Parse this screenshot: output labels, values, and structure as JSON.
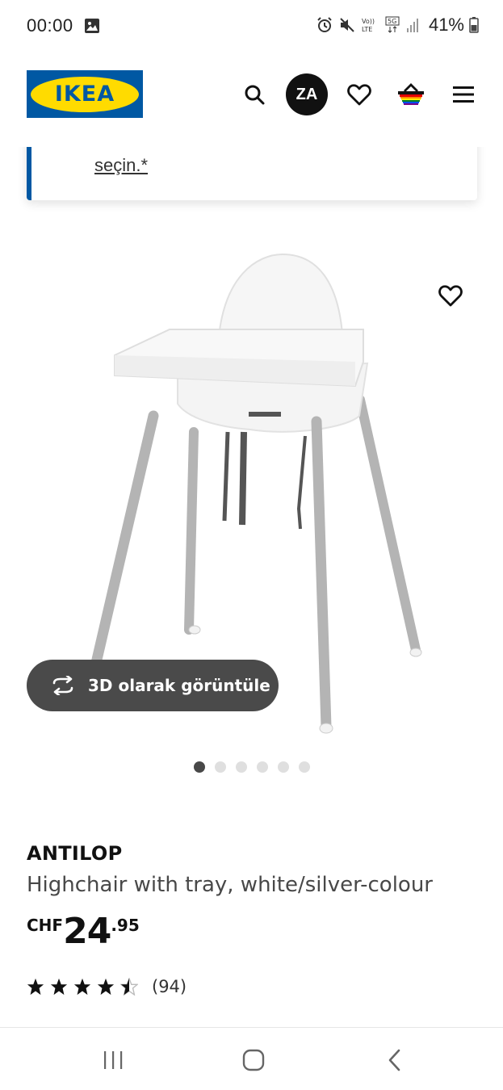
{
  "status_bar": {
    "time": "00:00",
    "battery": "41%",
    "icons": [
      "gallery-icon",
      "alarm-icon",
      "mute-icon",
      "volte-icon",
      "5g-icon",
      "signal-icon",
      "battery-icon"
    ]
  },
  "header": {
    "logo_text": "IKEA",
    "account_initials": "ZA",
    "icons": [
      "search-icon",
      "heart-icon",
      "basket-icon",
      "menu-icon"
    ]
  },
  "notice": {
    "link_text": "seçin.*"
  },
  "gallery": {
    "view_3d_label": "3D olarak görüntüle",
    "total_images": 6,
    "active_index": 0
  },
  "product": {
    "name": "ANTILOP",
    "description": "Highchair with tray, white/silver-colour",
    "price": {
      "currency": "CHF",
      "integer": "24",
      "decimal": ".95"
    },
    "rating": {
      "value": 4.5,
      "max": 5,
      "count_label": "(94)"
    }
  },
  "colors": {
    "brand_blue": "#0058a3",
    "brand_yellow": "#ffdb00",
    "button_dark": "#4a4a4a"
  }
}
